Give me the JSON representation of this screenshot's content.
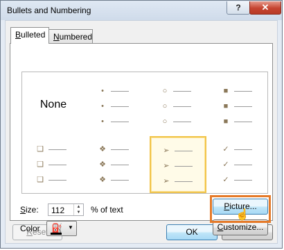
{
  "window": {
    "title": "Bullets and Numbering",
    "help_label": "?",
    "close_label": "✕"
  },
  "tabs": [
    {
      "mnemonic": "B",
      "rest": "ulleted",
      "active": true
    },
    {
      "mnemonic": "N",
      "rest": "umbered",
      "active": false
    }
  ],
  "gallery": {
    "selected_index": 6,
    "items": [
      {
        "type": "none",
        "label": "None"
      },
      {
        "type": "bullet",
        "glyph": "•",
        "icon": "small-dot-bullet-icon"
      },
      {
        "type": "bullet",
        "glyph": "○",
        "icon": "hollow-circle-bullet-icon"
      },
      {
        "type": "bullet",
        "glyph": "■",
        "icon": "square-bullet-icon"
      },
      {
        "type": "bullet",
        "glyph": "❑",
        "icon": "box-bullet-icon"
      },
      {
        "type": "bullet",
        "glyph": "❖",
        "icon": "diamond-cluster-bullet-icon"
      },
      {
        "type": "bullet",
        "glyph": "➢",
        "icon": "arrowhead-bullet-icon"
      },
      {
        "type": "bullet",
        "glyph": "✓",
        "icon": "checkmark-bullet-icon"
      }
    ]
  },
  "size": {
    "mnemonic": "S",
    "rest": "ize:",
    "value": "112",
    "unit_label": "% of text"
  },
  "color": {
    "label": "Color",
    "swatch": "#000000"
  },
  "buttons": {
    "picture": {
      "mnemonic": "P",
      "rest": "icture..."
    },
    "customize": {
      "mnemonic": "C",
      "rest": "ustomize..."
    },
    "reset": {
      "mnemonic": "R",
      "rest": "eset"
    },
    "ok": "OK",
    "cancel": "Cancel"
  },
  "colors": {
    "accent_highlight": "#e57a29",
    "selection_border": "#f1c44a",
    "bullet_color": "#8a7758"
  }
}
